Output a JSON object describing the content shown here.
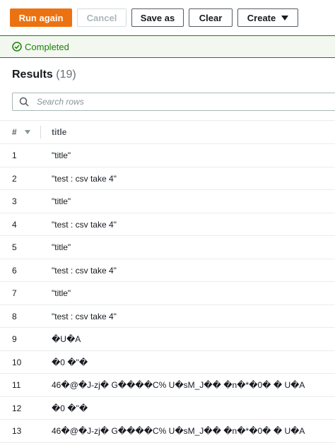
{
  "toolbar": {
    "run_again": "Run again",
    "cancel": "Cancel",
    "save_as": "Save as",
    "clear": "Clear",
    "create": "Create"
  },
  "status": {
    "text": "Completed",
    "color": "#1d8102"
  },
  "results": {
    "label": "Results",
    "count": "(19)"
  },
  "search": {
    "placeholder": "Search rows",
    "value": ""
  },
  "table": {
    "columns": [
      "#",
      "title"
    ],
    "rows": [
      {
        "num": "1",
        "title": "\"title\""
      },
      {
        "num": "2",
        "title": "\"test : csv take 4\""
      },
      {
        "num": "3",
        "title": "\"title\""
      },
      {
        "num": "4",
        "title": "\"test : csv take 4\""
      },
      {
        "num": "5",
        "title": "\"title\""
      },
      {
        "num": "6",
        "title": "\"test : csv take 4\""
      },
      {
        "num": "7",
        "title": "\"title\""
      },
      {
        "num": "8",
        "title": "\"test : csv take 4\""
      },
      {
        "num": "9",
        "title": "�U�A"
      },
      {
        "num": "10",
        "title": "�0 �\"�"
      },
      {
        "num": "11",
        "title": "46�@�J-zj� G����C% U�sM_J�� �n�*�0� � U�A"
      },
      {
        "num": "12",
        "title": "�0 �\"�"
      },
      {
        "num": "13",
        "title": "46�@�J-zj� G����C% U�sM_J�� �n�*�0� � U�A"
      }
    ]
  },
  "colors": {
    "primary": "#ec7211",
    "success": "#1d8102"
  }
}
